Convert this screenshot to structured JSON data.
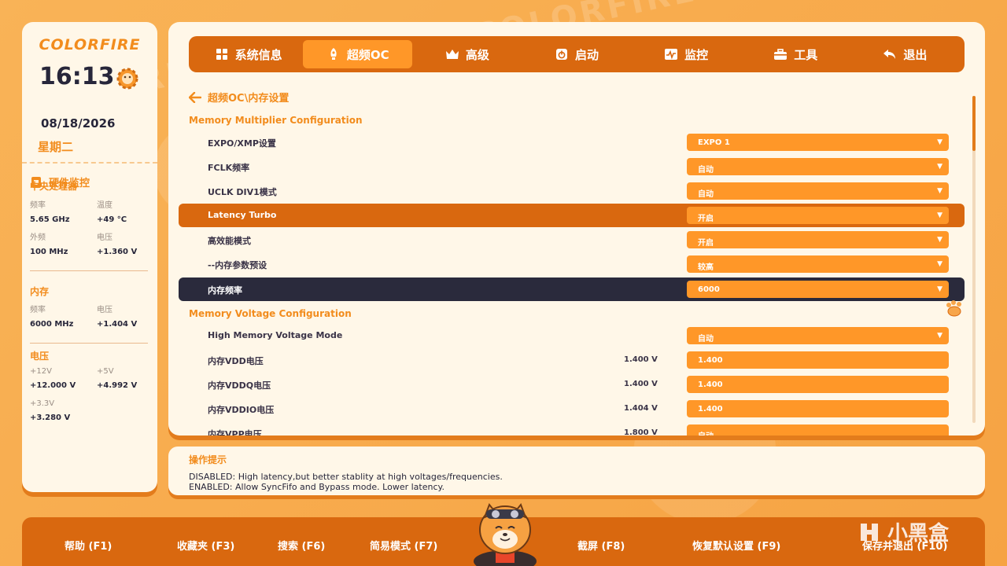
{
  "brand": {
    "logo": "COLORFIRE"
  },
  "clock": {
    "time": "16:13",
    "date": "08/18/2026",
    "weekday": "星期二"
  },
  "hardware": {
    "title": "硬件监控",
    "cpu": {
      "title": "中央处理器",
      "freq_label": "频率",
      "freq": "5.65 GHz",
      "temp_label": "温度",
      "temp": "+49 °C",
      "bclk_label": "外频",
      "bclk": "100 MHz",
      "volt_label": "电压",
      "volt": "+1.360 V"
    },
    "memory": {
      "title": "内存",
      "freq_label": "频率",
      "freq": "6000 MHz",
      "volt_label": "电压",
      "volt": "+1.404 V"
    },
    "voltage": {
      "title": "电压",
      "v12_label": "+12V",
      "v12": "+12.000 V",
      "v5_label": "+5V",
      "v5": "+4.992 V",
      "v33_label": "+3.3V",
      "v33": "+3.280 V"
    }
  },
  "tabs": [
    {
      "label": "系统信息",
      "icon": "grid-icon"
    },
    {
      "label": "超频OC",
      "icon": "rocket-icon",
      "active": true
    },
    {
      "label": "高级",
      "icon": "crown-icon"
    },
    {
      "label": "启动",
      "icon": "power-icon"
    },
    {
      "label": "监控",
      "icon": "monitor-icon"
    },
    {
      "label": "工具",
      "icon": "toolbox-icon"
    },
    {
      "label": "退出",
      "icon": "return-icon"
    }
  ],
  "breadcrumb": "超频OC\\内存设置",
  "sections": {
    "multiplier": "Memory Multiplier Configuration",
    "voltage": "Memory Voltage Configuration"
  },
  "settings": [
    {
      "label": "EXPO/XMP设置",
      "value": "EXPO 1"
    },
    {
      "label": "FCLK频率",
      "value": "自动"
    },
    {
      "label": "UCLK DIV1模式",
      "value": "自动"
    },
    {
      "label": "Latency Turbo",
      "value": "开启"
    },
    {
      "label": "高效能模式",
      "value": "开启"
    },
    {
      "label": "--内存参数预设",
      "value": "较高"
    },
    {
      "label": "内存频率",
      "value": "6000"
    },
    {
      "label": "High Memory Voltage Mode",
      "value": "自动"
    },
    {
      "label": "内存VDD电压",
      "current": "1.400 V",
      "value": "1.400"
    },
    {
      "label": "内存VDDQ电压",
      "current": "1.400 V",
      "value": "1.400"
    },
    {
      "label": "内存VDDIO电压",
      "current": "1.404 V",
      "value": "1.400"
    },
    {
      "label": "内存VPP电压",
      "current": "1.800 V",
      "value": "自动"
    }
  ],
  "hint": {
    "title": "操作提示",
    "line1": "DISABLED: High latency,but better stablity at high voltages/frequencies.",
    "line2": "ENABLED: Allow SyncFifo and Bypass mode. Lower latency."
  },
  "footer": {
    "help": "帮助 (F1)",
    "favorites": "收藏夹 (F3)",
    "search": "搜索 (F6)",
    "easy_mode": "简易模式 (F7)",
    "screenshot": "截屏 (F8)",
    "restore": "恢复默认设置 (F9)",
    "save_exit": "保存并退出 (F10)"
  },
  "watermark": "小黑盒",
  "colors": {
    "accent": "#ff9728",
    "dark_accent": "#d9680f",
    "panel": "#fff7e8",
    "selected_row": "#2a2a3c"
  }
}
